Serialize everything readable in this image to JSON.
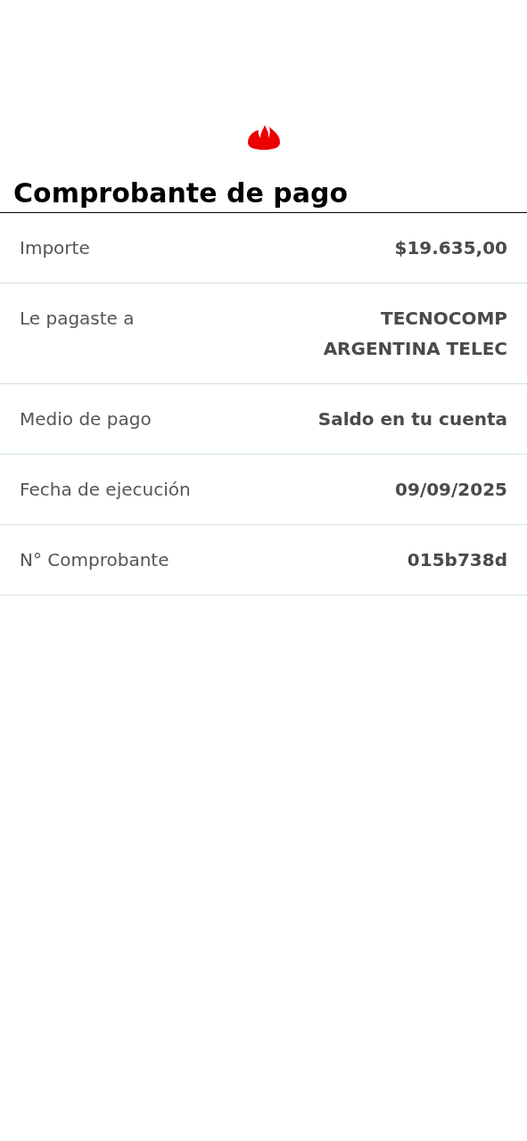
{
  "title": "Comprobante de pago",
  "rows": [
    {
      "label": "Importe",
      "value": "$19.635,00"
    },
    {
      "label": "Le pagaste a",
      "value": "TECNOCOMP ARGENTINA TELEC"
    },
    {
      "label": "Medio de pago",
      "value": "Saldo en tu cuenta"
    },
    {
      "label": "Fecha de ejecución",
      "value": "09/09/2025"
    },
    {
      "label": "N° Comprobante",
      "value": "015b738d"
    }
  ]
}
